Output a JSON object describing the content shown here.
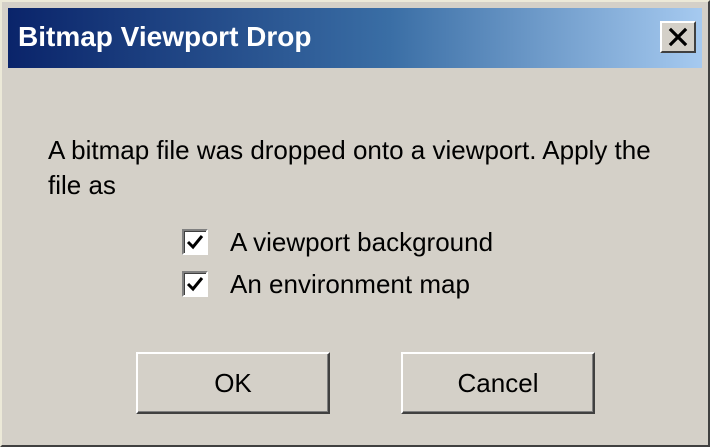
{
  "window": {
    "title": "Bitmap Viewport Drop",
    "close_icon": "close-icon"
  },
  "message": "A bitmap file was dropped onto a viewport. Apply the file as",
  "options": [
    {
      "label": "A viewport background",
      "checked": true
    },
    {
      "label": "An environment map",
      "checked": true
    }
  ],
  "buttons": {
    "ok": "OK",
    "cancel": "Cancel"
  },
  "colors": {
    "titlebar_start": "#0a246a",
    "titlebar_end": "#a6caf0",
    "face": "#d4d0c8"
  }
}
